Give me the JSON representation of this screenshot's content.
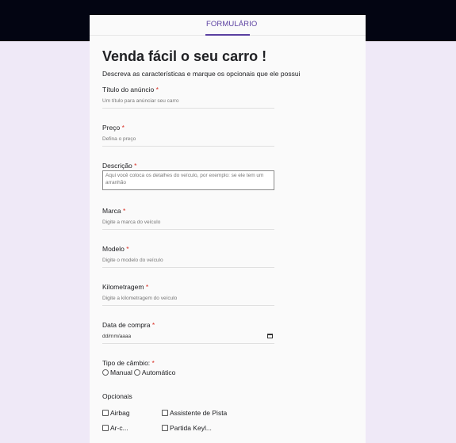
{
  "tabs": {
    "active": "FORMULÁRIO"
  },
  "form": {
    "title": "Venda fácil o seu carro !",
    "subtitle": "Descreva as características e marque os opcionais que ele possui",
    "required_mark": "*",
    "fields": [
      {
        "label": "Título do anúncio",
        "placeholder": "Um título para anúnciar seu carro"
      },
      {
        "label": "Preço",
        "placeholder": "Defina o preço"
      },
      {
        "label": "Descrição",
        "placeholder": "Aqui você coloca os detalhes do veículo, por exemplo: se ele tem um arranhão"
      },
      {
        "label": "Marca",
        "placeholder": "Digite a marca do veículo"
      },
      {
        "label": "Modelo",
        "placeholder": "Digite o modelo do veículo"
      },
      {
        "label": "Kilometragem",
        "placeholder": "Digite a kilometragem do veículo"
      },
      {
        "label": "Data de compra",
        "placeholder": "dd/mm/aaaa"
      },
      {
        "label": "Tipo de câmbio:"
      }
    ],
    "transmission_options": [
      "Manual",
      "Automático"
    ],
    "optionals_title": "Opcionais",
    "optionals": [
      "Airbag",
      "Assistente de Pista",
      "Ar-c...",
      "Partida Keyl..."
    ]
  }
}
